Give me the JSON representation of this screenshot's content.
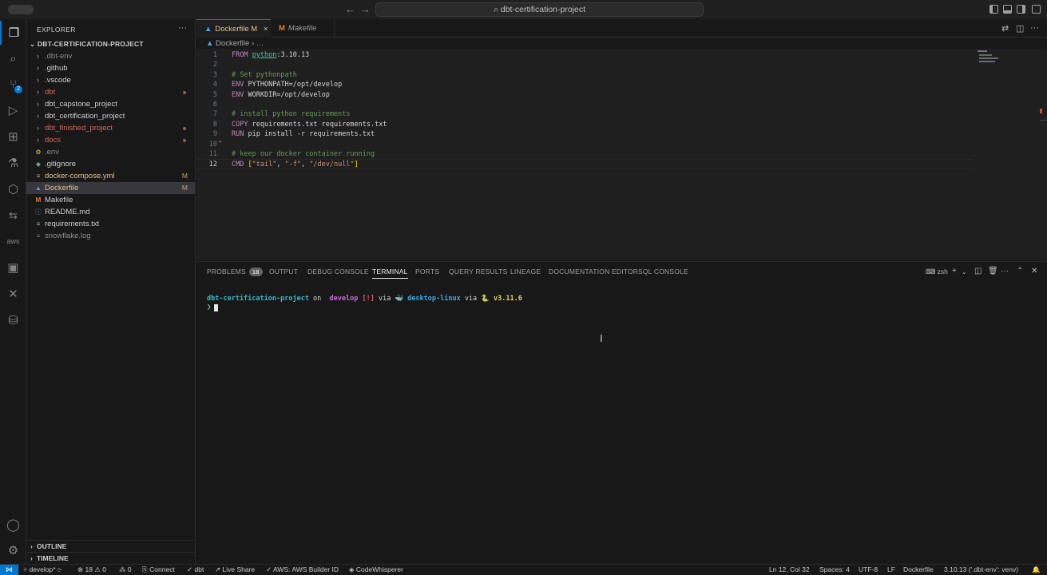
{
  "titlebar": {
    "search": "dbt-certification-project",
    "back": "←",
    "forward": "→"
  },
  "activity": {
    "explorer": "❐",
    "search": "⌕",
    "scm": "⑂",
    "scm_badge": "2",
    "run": "▷",
    "extensions": "⊞",
    "testing": "⚗",
    "remote": "⬡",
    "aws": "aws",
    "docker": "▣",
    "x": "✕",
    "database": "⛁",
    "account": "◯",
    "settings": "⚙"
  },
  "sidebar": {
    "title": "EXPLORER",
    "more": "···",
    "project": "DBT-CERTIFICATION-PROJECT",
    "items": [
      {
        "label": ".dbt-env",
        "type": "folder"
      },
      {
        "label": ".github",
        "type": "folder"
      },
      {
        "label": ".vscode",
        "type": "folder"
      },
      {
        "label": "dbt",
        "type": "folder"
      },
      {
        "label": "dbt_capstone_project",
        "type": "folder"
      },
      {
        "label": "dbt_certification_project",
        "type": "folder"
      },
      {
        "label": "dbt_finished_project",
        "type": "folder"
      },
      {
        "label": "docs",
        "type": "folder"
      },
      {
        "label": ".env",
        "type": "file"
      },
      {
        "label": ".gitignore",
        "type": "file"
      },
      {
        "label": "docker-compose.yml",
        "type": "file",
        "badge": "M"
      },
      {
        "label": "Dockerfile",
        "type": "file",
        "badge": "M"
      },
      {
        "label": "Makefile",
        "type": "file"
      },
      {
        "label": "README.md",
        "type": "file"
      },
      {
        "label": "requirements.txt",
        "type": "file"
      },
      {
        "label": "snowflake.log",
        "type": "file"
      }
    ],
    "outline": "OUTLINE",
    "timeline": "TIMELINE"
  },
  "tabs": [
    {
      "label": "Dockerfile",
      "badge": "M",
      "close": "×"
    },
    {
      "label": "Makefile"
    }
  ],
  "breadcrumb": {
    "file": "Dockerfile",
    "rest": "…"
  },
  "editor": {
    "line_numbers": [
      "1",
      "2",
      "3",
      "4",
      "5",
      "6",
      "7",
      "8",
      "9",
      "10",
      "11",
      "12"
    ],
    "lines": {
      "l1_kw": "FROM",
      "l1_img": "python",
      "l1_tag": ":3.10.13",
      "l3": "# Set pythonpath",
      "l4_kw": "ENV",
      "l4_rest": "PYTHONPATH=/opt/develop",
      "l5_kw": "ENV",
      "l5_rest": "WORKDIR=/opt/develop",
      "l7": "# install python requirements",
      "l8_kw": "COPY",
      "l8_rest": "requirements.txt requirements.txt",
      "l9_kw": "RUN",
      "l9_rest": "pip install -r requirements.txt",
      "l11": "# keep our docker container running",
      "l12_kw": "CMD",
      "l12_a": "\"tail\"",
      "l12_b": "\"-f\"",
      "l12_c": "\"/dev/null\""
    }
  },
  "panel": {
    "tabs": [
      "PROBLEMS",
      "OUTPUT",
      "DEBUG CONSOLE",
      "TERMINAL",
      "PORTS",
      "QUERY RESULTS",
      "LINEAGE",
      "DOCUMENTATION EDITOR",
      "SQL CONSOLE"
    ],
    "problems_count": "18",
    "active_tab": "TERMINAL",
    "shell": "zsh",
    "terminal": {
      "project": "dbt-certification-project",
      "on": " on ",
      "branch": " develop",
      "status": " [!]",
      "via1": " via ",
      "docker_ctx": " desktop-linux",
      "via2": " via ",
      "python": " v3.11.6",
      "prompt": "❯"
    }
  },
  "statusbar": {
    "branch": "develop*",
    "errors": "18",
    "warnings": "0",
    "infos": "0",
    "connect": "Connect",
    "dbt": "dbt",
    "liveshare": "Live Share",
    "aws": "AWS: AWS Builder ID",
    "codewhisperer": "CodeWhisperer",
    "position": "Ln 12, Col 32",
    "spaces": "Spaces: 4",
    "encoding": "UTF-8",
    "eol": "LF",
    "language": "Dockerfile",
    "interpreter": "3.10.13 ('.dbt-env': venv)"
  }
}
